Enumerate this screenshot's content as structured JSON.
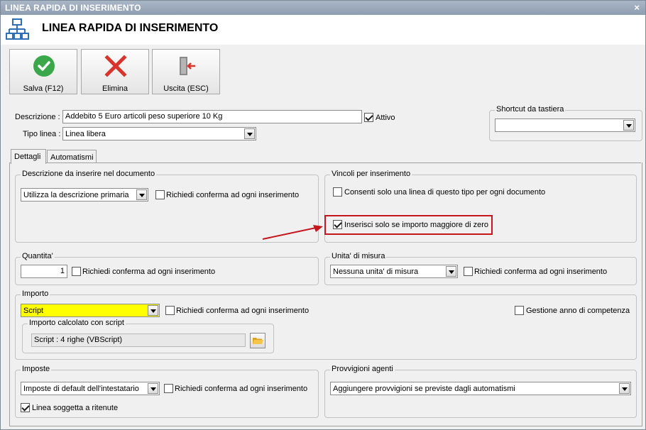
{
  "window": {
    "title": "LINEA RAPIDA DI INSERIMENTO",
    "close_glyph": "×"
  },
  "header": {
    "title": "LINEA RAPIDA DI INSERIMENTO",
    "icon": "network-icon"
  },
  "toolbar": {
    "save_label": "Salva (F12)",
    "delete_label": "Elimina",
    "exit_label": "Uscita (ESC)"
  },
  "form": {
    "descrizione_label": "Descrizione :",
    "descrizione_value": "Addebito 5 Euro articoli peso superiore 10 Kg",
    "attivo_label": "Attivo",
    "attivo_checked": true,
    "tipo_linea_label": "Tipo linea :",
    "tipo_linea_value": "Linea libera",
    "shortcut_group": "Shortcut da tastiera",
    "shortcut_value": ""
  },
  "tabs": [
    "Dettagli",
    "Automatismi"
  ],
  "descrizione_doc": {
    "group": "Descrizione da inserire nel documento",
    "combo_value": "Utilizza la descrizione primaria",
    "confirm_label": "Richiedi conferma ad ogni inserimento"
  },
  "vincoli": {
    "group": "Vincoli per inserimento",
    "one_line_label": "Consenti solo una linea di questo tipo per ogni documento",
    "one_line_checked": false,
    "positive_label": "Inserisci solo se importo maggiore di zero",
    "positive_checked": true
  },
  "quantita": {
    "group": "Quantita'",
    "value": "1",
    "confirm_label": "Richiedi conferma ad ogni inserimento"
  },
  "unita": {
    "group": "Unita' di misura",
    "combo_value": "Nessuna unita' di misura",
    "confirm_label": "Richiedi conferma ad ogni inserimento"
  },
  "importo": {
    "group": "Importo",
    "combo_value": "Script",
    "confirm_label": "Richiedi conferma ad ogni inserimento",
    "anno_label": "Gestione anno di competenza",
    "script_group": "Importo calcolato con script",
    "script_value": "Script : 4 righe (VBScript)"
  },
  "imposte": {
    "group": "Imposte",
    "combo_value": "Imposte di default dell'intestatario",
    "confirm_label": "Richiedi conferma ad ogni inserimento",
    "ritenute_label": "Linea soggetta a ritenute",
    "ritenute_checked": true
  },
  "provvigioni": {
    "group": "Provvigioni agenti",
    "combo_value": "Aggiungere provvigioni se previste dagli automatismi"
  },
  "colors": {
    "highlight": "#c4161c",
    "script_bg": "#ffff00",
    "save_green": "#3aa84a",
    "delete_red": "#d9342b"
  }
}
